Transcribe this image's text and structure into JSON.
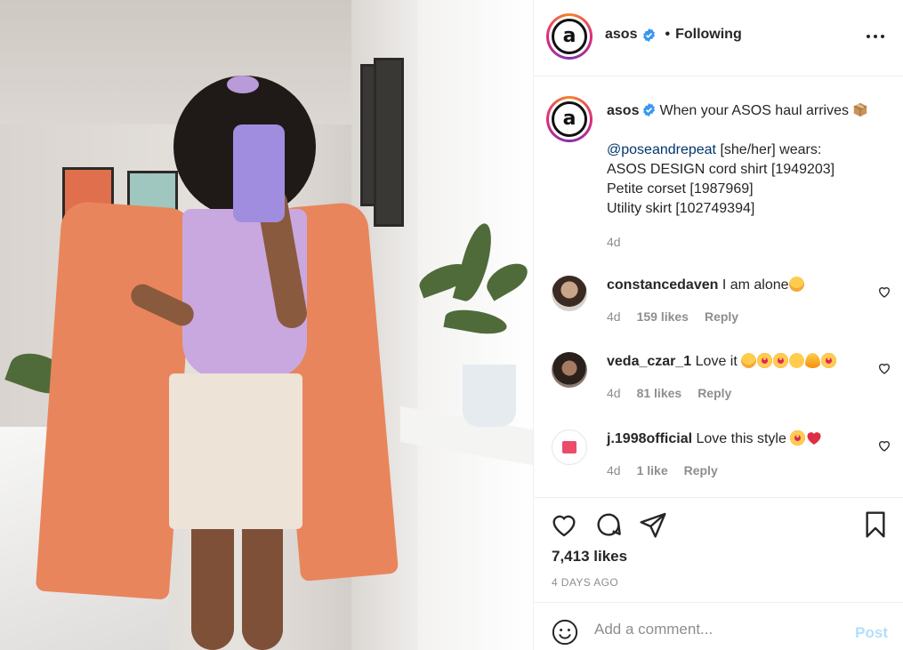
{
  "header": {
    "username": "asos",
    "separator": "•",
    "follow_status": "Following",
    "avatar_letter": "a"
  },
  "caption": {
    "username": "asos",
    "headline": "When your ASOS haul arrives",
    "mention": "@poseandrepeat",
    "mention_suffix": " [she/her] wears:",
    "lines": [
      "ASOS DESIGN cord shirt [1949203]",
      "Petite corset [1987969]",
      "Utility skirt [102749394]"
    ],
    "time": "4d"
  },
  "comments": [
    {
      "username": "constancedaven",
      "text": "I am alone",
      "time": "4d",
      "likes": "159 likes",
      "reply": "Reply"
    },
    {
      "username": "veda_czar_1",
      "text": "Love it",
      "time": "4d",
      "likes": "81 likes",
      "reply": "Reply"
    },
    {
      "username": "j.1998official",
      "text": "Love this style",
      "time": "4d",
      "likes": "1 like",
      "reply": "Reply"
    }
  ],
  "actions": {
    "likes": "7,413 likes",
    "posted": "4 DAYS AGO"
  },
  "add_comment": {
    "placeholder": "Add a comment...",
    "post_label": "Post"
  },
  "colors": {
    "verified": "#3897f0",
    "mention": "#00376b",
    "muted": "#8e8e8e",
    "post_disabled": "#b2dffc"
  },
  "icons": [
    "verified-badge-icon",
    "more-options-icon",
    "package-icon",
    "heart-icon",
    "comment-icon",
    "share-icon",
    "bookmark-icon",
    "smiley-icon"
  ]
}
